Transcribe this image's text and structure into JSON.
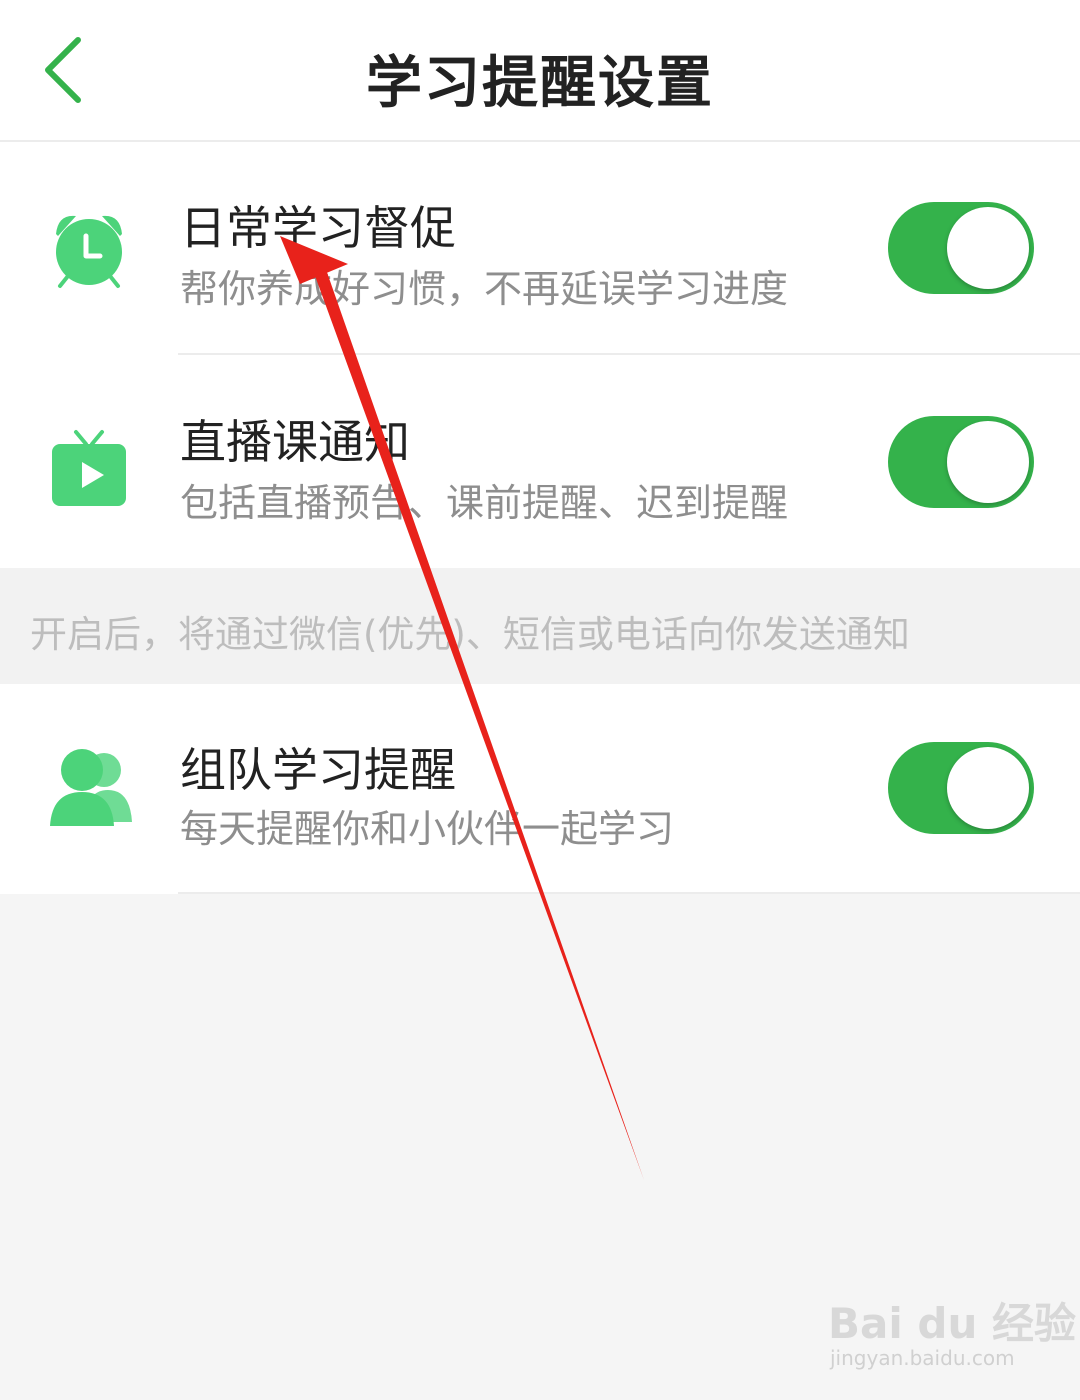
{
  "header": {
    "title": "学习提醒设置",
    "back_icon": "chevron-left-icon"
  },
  "colors": {
    "accent": "#34b24b",
    "icon_green": "#4cd37a",
    "title": "#222222",
    "desc": "#8e8e8e",
    "arrow": "#e8221b"
  },
  "settings": [
    {
      "icon": "alarm-clock-icon",
      "title": "日常学习督促",
      "desc": "帮你养成好习惯，不再延误学习进度",
      "enabled": true
    },
    {
      "icon": "tv-play-icon",
      "title": "直播课通知",
      "desc": "包括直播预告、课前提醒、迟到提醒",
      "enabled": true
    },
    {
      "icon": "users-icon",
      "title": "组队学习提醒",
      "desc": "每天提醒你和小伙伴一起学习",
      "enabled": true
    }
  ],
  "notice": {
    "text": "开启后，将通过微信(优先)、短信或电话向你发送通知"
  },
  "watermark": {
    "logo": "Bai du 经验",
    "url": "jingyan.baidu.com"
  }
}
